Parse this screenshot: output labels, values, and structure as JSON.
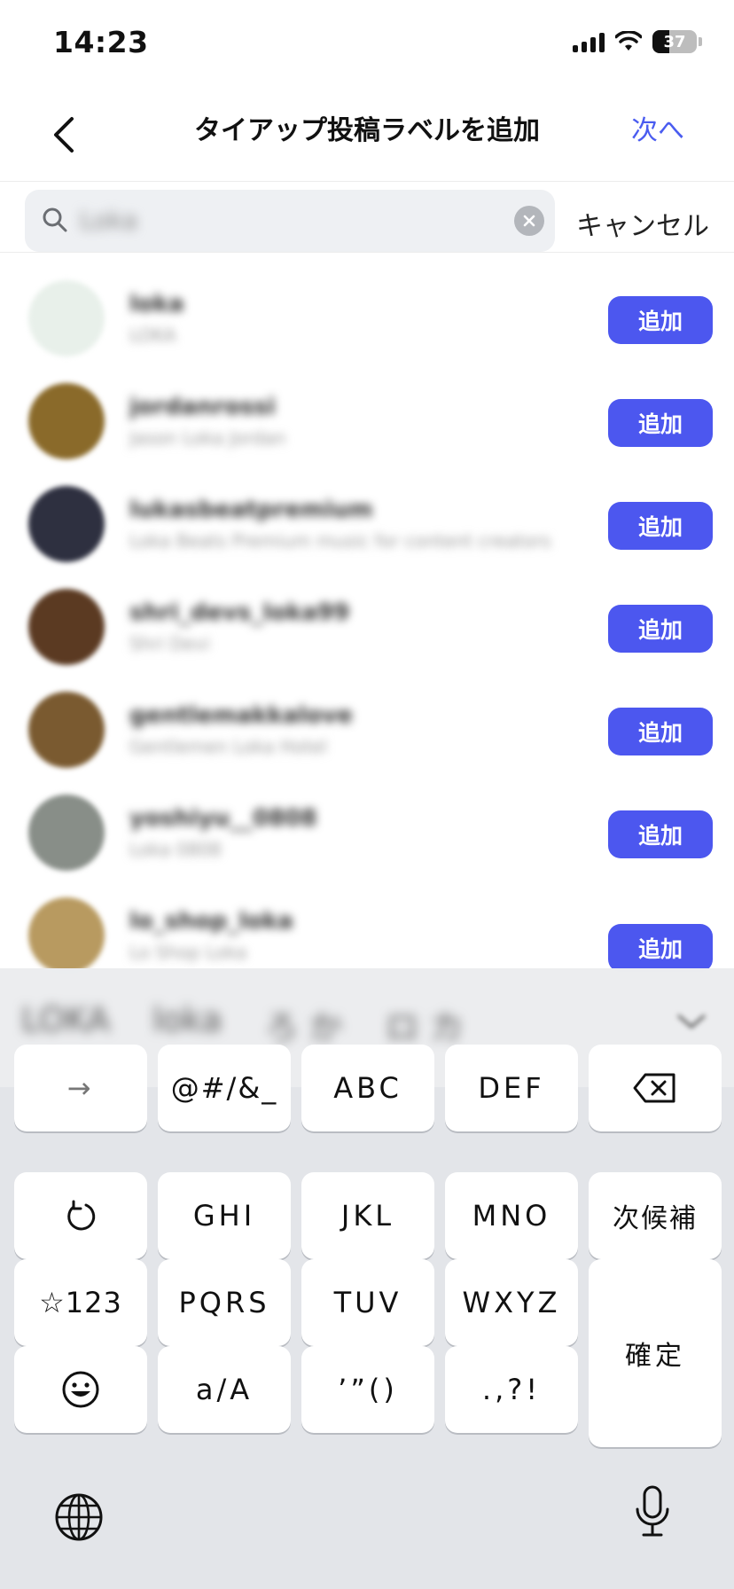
{
  "status": {
    "time": "14:23",
    "battery": "37"
  },
  "nav": {
    "title": "タイアップ投稿ラベルを追加",
    "next": "次へ"
  },
  "search": {
    "value": "Loka",
    "cancel": "キャンセル"
  },
  "results": [
    {
      "name": "loka",
      "sub": "LOKA",
      "avatar": "#e8f0ea",
      "add": "追加"
    },
    {
      "name": "jordanrossi",
      "sub": "Jason Loka Jordan",
      "avatar": "#8a6a2a",
      "add": "追加"
    },
    {
      "name": "lukasbeatpremium",
      "sub": "Loka Beats Premium music for content creators",
      "avatar": "#2e3040",
      "add": "追加"
    },
    {
      "name": "shri_devs_loka99",
      "sub": "Shri Devi",
      "avatar": "#5b3a22",
      "add": "追加"
    },
    {
      "name": "gentlemakkalove",
      "sub": "Gentlemen Loka Hotel",
      "avatar": "#7a5a30",
      "add": "追加"
    },
    {
      "name": "yoshiyu__0808",
      "sub": "Loka 0808",
      "avatar": "#888e88",
      "add": "追加"
    },
    {
      "name": "lo_shop_loka",
      "sub": "Lo Shop Loka",
      "avatar": "#b89a60",
      "add": "追加"
    }
  ],
  "keyboard": {
    "suggestions": [
      "LOKA",
      "loka",
      "ろ か",
      "ロ カ"
    ],
    "keys": {
      "arrow": "→",
      "symbols": "@#/&_",
      "abc": "ABC",
      "def": "DEF",
      "undo": "↺",
      "ghi": "GHI",
      "jkl": "JKL",
      "mno": "MNO",
      "next_candidate": "次候補",
      "num": "☆123",
      "pqrs": "PQRS",
      "tuv": "TUV",
      "wxyz": "WXYZ",
      "confirm": "確定",
      "case": "a/A",
      "quotes": "’”()",
      "punct": ".,?!"
    }
  }
}
